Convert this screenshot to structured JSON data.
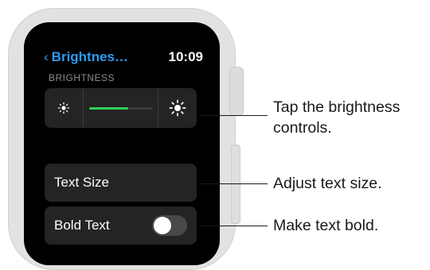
{
  "watch": {
    "header": {
      "back_label": "Brightnes…",
      "time": "10:09"
    },
    "section_label": "BRIGHTNESS",
    "brightness": {
      "level": 0.62,
      "fill_color": "#2ed158",
      "decrease_icon": "sun-small-icon",
      "increase_icon": "sun-large-icon"
    },
    "rows": {
      "text_size": "Text Size",
      "bold_text": "Bold Text"
    },
    "bold_toggle_on": false,
    "accent_color": "#2c9bf0"
  },
  "callouts": {
    "brightness_line1": "Tap the brightness",
    "brightness_line2": "controls.",
    "text_size": "Adjust text size.",
    "bold": "Make text bold."
  }
}
